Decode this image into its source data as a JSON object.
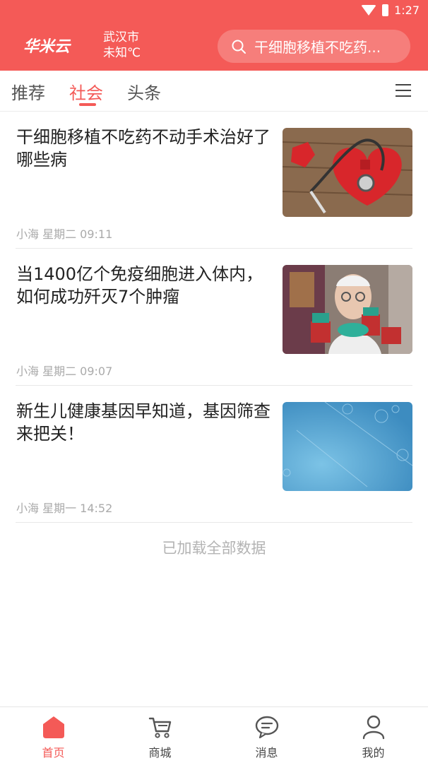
{
  "status_bar": {
    "time": "1:27"
  },
  "header": {
    "logo_text": "华米云",
    "city": "武汉市",
    "weather": "未知℃",
    "search_placeholder": "干细胞移植不吃药..."
  },
  "tabs": [
    {
      "label": "推荐",
      "active": false
    },
    {
      "label": "社会",
      "active": true
    },
    {
      "label": "头条",
      "active": false
    }
  ],
  "articles": [
    {
      "title": "干细胞移植不吃药不动手术治好了哪些病",
      "meta": "小海 星期二 09:11",
      "thumb": "heart-puzzle-stethoscope-image"
    },
    {
      "title": "当1400亿个免疫细胞进入体内，如何成功歼灭7个肿瘤",
      "meta": "小海 星期二 09:07",
      "thumb": "scientist-lab-image"
    },
    {
      "title": "新生儿健康基因早知道，基因筛查来把关！",
      "meta": "小海 星期一 14:52",
      "thumb": "blue-virus-image"
    }
  ],
  "footer_text": "已加载全部数据",
  "bottom_nav": [
    {
      "label": "首页",
      "icon": "home-icon",
      "active": true
    },
    {
      "label": "商城",
      "icon": "cart-icon",
      "active": false
    },
    {
      "label": "消息",
      "icon": "message-icon",
      "active": false
    },
    {
      "label": "我的",
      "icon": "user-icon",
      "active": false
    }
  ],
  "colors": {
    "brand": "#f45a57",
    "text": "#222222",
    "meta": "#aaaaaa"
  }
}
